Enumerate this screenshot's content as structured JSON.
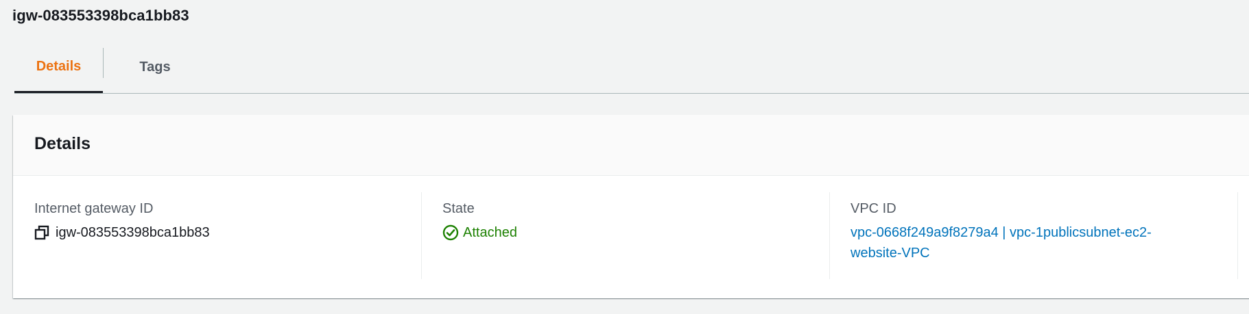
{
  "page": {
    "title": "igw-083553398bca1bb83"
  },
  "tabs": [
    {
      "label": "Details",
      "selected": true
    },
    {
      "label": "Tags",
      "selected": false
    }
  ],
  "details": {
    "title": "Details",
    "fields": {
      "gateway_id": {
        "label": "Internet gateway ID",
        "value": "igw-083553398bca1bb83",
        "icon": "copy-icon"
      },
      "state": {
        "label": "State",
        "value": "Attached",
        "icon": "check-circle-icon",
        "color": "#1d8102"
      },
      "vpc_id": {
        "label": "VPC ID",
        "value": "vpc-0668f249a9f8279a4 | vpc-1publicsubnet-ec2-website-VPC"
      }
    }
  },
  "colors": {
    "accent": "#ec7211",
    "link": "#0073bb",
    "success": "#1d8102",
    "background": "#f2f3f3"
  }
}
